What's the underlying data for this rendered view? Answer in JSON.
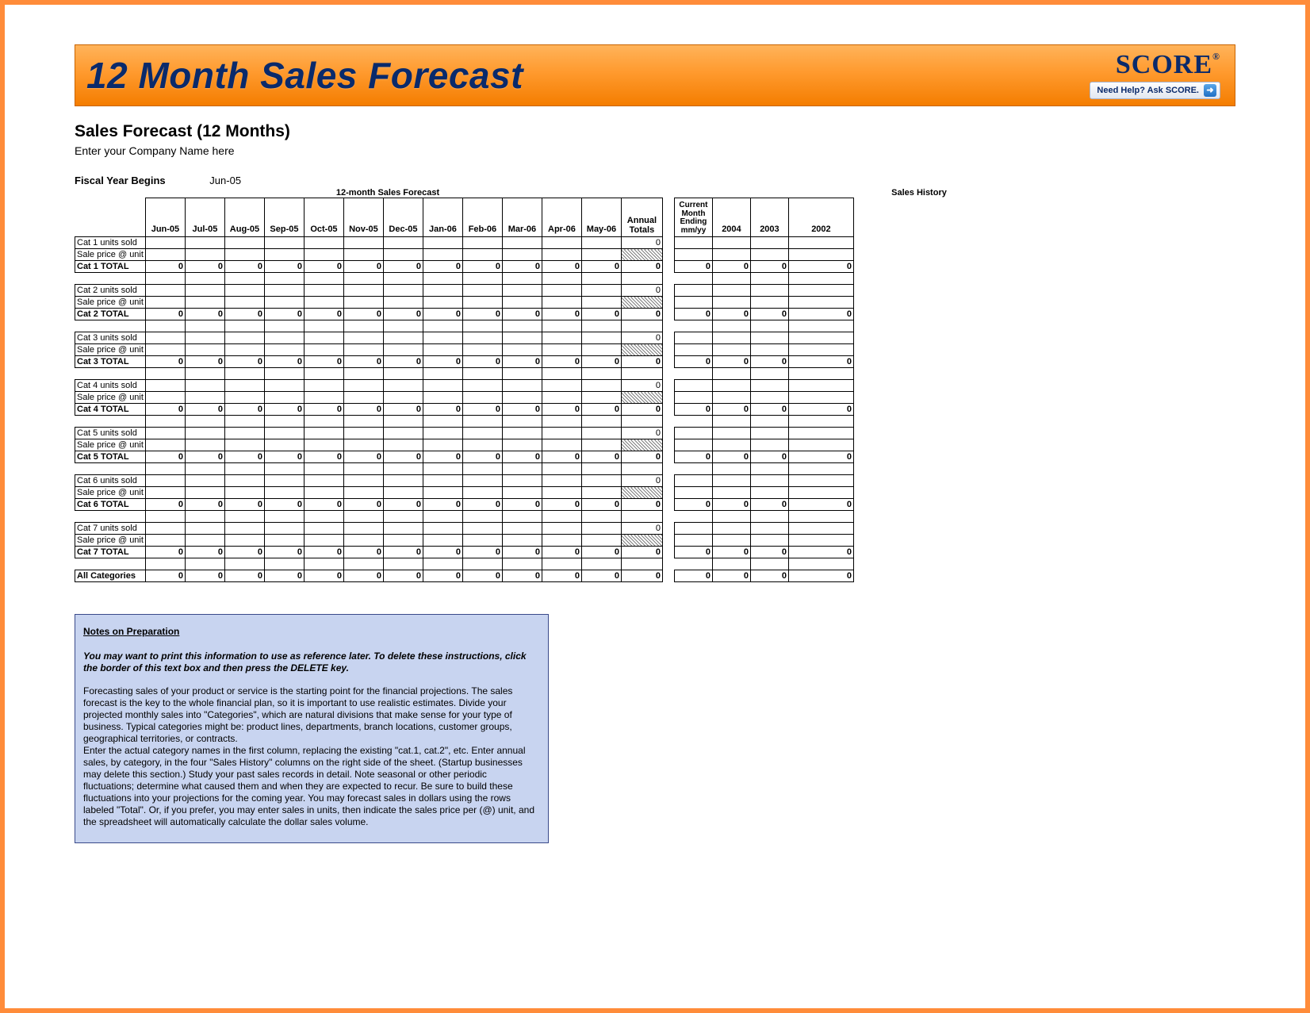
{
  "banner": {
    "title": "12 Month Sales Forecast",
    "logo_text": "SCORE",
    "reg_mark": "®",
    "help_text": "Need Help? Ask SCORE."
  },
  "header": {
    "title": "Sales Forecast (12 Months)",
    "company_placeholder": "Enter your Company Name here",
    "fiscal_label": "Fiscal Year Begins",
    "fiscal_value": "Jun-05"
  },
  "section_labels": {
    "forecast": "12-month Sales Forecast",
    "history": "Sales History"
  },
  "forecast_columns": [
    "Jun-05",
    "Jul-05",
    "Aug-05",
    "Sep-05",
    "Oct-05",
    "Nov-05",
    "Dec-05",
    "Jan-06",
    "Feb-06",
    "Mar-06",
    "Apr-06",
    "May-06"
  ],
  "annual_label": "Annual Totals",
  "history_columns": {
    "current_month": "Current Month Ending mm/yy",
    "years": [
      "2004",
      "2003",
      "2002"
    ]
  },
  "categories": [
    {
      "units_label": "Cat 1 units sold",
      "price_label": "Sale price @ unit",
      "total_label": "Cat 1 TOTAL",
      "units_annual": "0",
      "totals": [
        "0",
        "0",
        "0",
        "0",
        "0",
        "0",
        "0",
        "0",
        "0",
        "0",
        "0",
        "0"
      ],
      "total_annual": "0",
      "hist_totals": [
        "0",
        "0",
        "0",
        "0"
      ]
    },
    {
      "units_label": "Cat 2 units sold",
      "price_label": "Sale price @ unit",
      "total_label": "Cat 2 TOTAL",
      "units_annual": "0",
      "totals": [
        "0",
        "0",
        "0",
        "0",
        "0",
        "0",
        "0",
        "0",
        "0",
        "0",
        "0",
        "0"
      ],
      "total_annual": "0",
      "hist_totals": [
        "0",
        "0",
        "0",
        "0"
      ]
    },
    {
      "units_label": "Cat 3 units sold",
      "price_label": "Sale price @ unit",
      "total_label": "Cat 3 TOTAL",
      "units_annual": "0",
      "totals": [
        "0",
        "0",
        "0",
        "0",
        "0",
        "0",
        "0",
        "0",
        "0",
        "0",
        "0",
        "0"
      ],
      "total_annual": "0",
      "hist_totals": [
        "0",
        "0",
        "0",
        "0"
      ]
    },
    {
      "units_label": "Cat 4 units sold",
      "price_label": "Sale price @ unit",
      "total_label": "Cat 4 TOTAL",
      "units_annual": "0",
      "totals": [
        "0",
        "0",
        "0",
        "0",
        "0",
        "0",
        "0",
        "0",
        "0",
        "0",
        "0",
        "0"
      ],
      "total_annual": "0",
      "hist_totals": [
        "0",
        "0",
        "0",
        "0"
      ]
    },
    {
      "units_label": "Cat 5 units sold",
      "price_label": "Sale price @ unit",
      "total_label": "Cat 5 TOTAL",
      "units_annual": "0",
      "totals": [
        "0",
        "0",
        "0",
        "0",
        "0",
        "0",
        "0",
        "0",
        "0",
        "0",
        "0",
        "0"
      ],
      "total_annual": "0",
      "hist_totals": [
        "0",
        "0",
        "0",
        "0"
      ]
    },
    {
      "units_label": "Cat 6 units sold",
      "price_label": "Sale price @ unit",
      "total_label": "Cat 6 TOTAL",
      "units_annual": "0",
      "totals": [
        "0",
        "0",
        "0",
        "0",
        "0",
        "0",
        "0",
        "0",
        "0",
        "0",
        "0",
        "0"
      ],
      "total_annual": "0",
      "hist_totals": [
        "0",
        "0",
        "0",
        "0"
      ]
    },
    {
      "units_label": "Cat 7 units sold",
      "price_label": "Sale price @ unit",
      "total_label": "Cat 7 TOTAL",
      "units_annual": "0",
      "totals": [
        "0",
        "0",
        "0",
        "0",
        "0",
        "0",
        "0",
        "0",
        "0",
        "0",
        "0",
        "0"
      ],
      "total_annual": "0",
      "hist_totals": [
        "0",
        "0",
        "0",
        "0"
      ]
    }
  ],
  "all_categories": {
    "label": "All Categories",
    "totals": [
      "0",
      "0",
      "0",
      "0",
      "0",
      "0",
      "0",
      "0",
      "0",
      "0",
      "0",
      "0"
    ],
    "annual": "0",
    "hist": [
      "0",
      "0",
      "0",
      "0"
    ]
  },
  "notes": {
    "title": "Notes on Preparation",
    "lead": "You may want to print this information to use as reference later. To delete these instructions, click the border of this text box and then press the DELETE key.",
    "para1": "Forecasting sales of your product or service is the starting point for the financial projections. The sales forecast is the key to the whole financial plan, so it is important to use realistic estimates. Divide your projected monthly sales into \"Categories\", which are natural divisions that make sense for your type of business. Typical categories might be: product lines, departments, branch locations, customer groups, geographical territories, or contracts.",
    "para2": "Enter the actual category names in the first column, replacing the existing \"cat.1, cat.2\", etc. Enter annual sales, by category, in the four \"Sales History\" columns on the right side of the sheet. (Startup businesses may delete this section.) Study your past sales records in detail. Note seasonal or other periodic fluctuations; determine what caused them and when they are expected to recur. Be sure to build these fluctuations into your projections for the coming year. You may forecast sales in dollars using the rows labeled \"Total\".  Or, if you prefer, you may enter sales in units, then indicate the sales price per (@) unit, and the spreadsheet will automatically calculate the dollar sales volume."
  }
}
